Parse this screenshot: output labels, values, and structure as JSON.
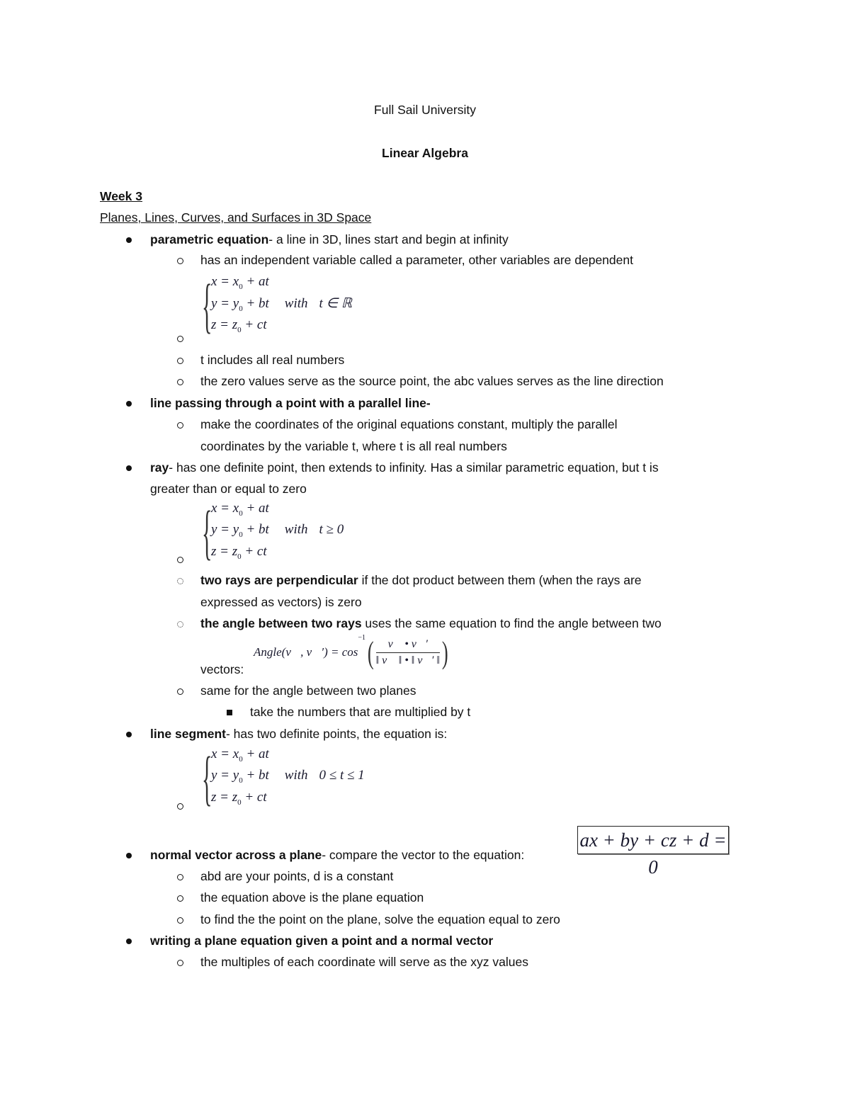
{
  "header": {
    "school": "Full Sail University",
    "course": "Linear Algebra",
    "week": "Week 3",
    "topic": "Planes, Lines, Curves, and Surfaces in 3D Space"
  },
  "items": {
    "parametric": {
      "term": "parametric equation",
      "text": "- a line in 3D, lines start and begin at infinity",
      "sub1": "has an independent variable called a parameter, other variables are dependent",
      "eq": {
        "x": "x = x",
        "x_rest": " + at",
        "y": "y = y",
        "y_rest": " + bt",
        "z": "z = z",
        "z_rest": " + ct",
        "sub": "0",
        "with": "with",
        "cond": "t ∈ ℝ"
      },
      "sub3": "t includes all real numbers",
      "sub4": "the zero values serve as the source point, the abc values serves as the line direction"
    },
    "parallel": {
      "term": "line passing through a point with a parallel line-",
      "sub1_line1": "make the coordinates of the original equations constant, multiply the parallel",
      "sub1_line2": "coordinates by the variable t, where t is all real numbers"
    },
    "ray": {
      "term": "ray",
      "text_line1": "- has one definite point, then extends to infinity. Has a similar parametric equation, but t is",
      "text_line2": "greater than or equal to zero",
      "eq_cond": "t ≥ 0",
      "perp_term": "two rays are perpendicular",
      "perp_text": " if the dot product between them (when the rays are",
      "perp_text2": "expressed as vectors) is zero",
      "angle_term": "the angle between two rays",
      "angle_text": " uses the same equation to find the angle between two",
      "angle_text2": "vectors:",
      "angle_formula_lhs": "Angle(v⃗, v⃗′) = cos",
      "angle_formula_exp": "−1",
      "angle_num": "v⃗ • v⃗′",
      "angle_den": "‖ v⃗ ‖ • ‖ v⃗′ ‖",
      "planes": "same for the angle between two planes",
      "planes_sub": "take the numbers that are multiplied by t"
    },
    "segment": {
      "term": "line segment",
      "text": "- has two definite points, the equation is:",
      "eq_cond": "0 ≤ t ≤ 1"
    },
    "normal": {
      "term": "normal vector across a plane",
      "text": "- compare the vector to the equation:",
      "plane_eq": "ax + by + cz + d = 0",
      "sub1": "abd are your points, d is a constant",
      "sub2": "the equation above is the plane equation",
      "sub3": "to find the the point on the plane, solve the equation equal to zero"
    },
    "writing": {
      "term": "writing a plane equation given a point and a normal vector",
      "sub1": "the multiples of each coordinate will serve as the xyz values"
    }
  }
}
